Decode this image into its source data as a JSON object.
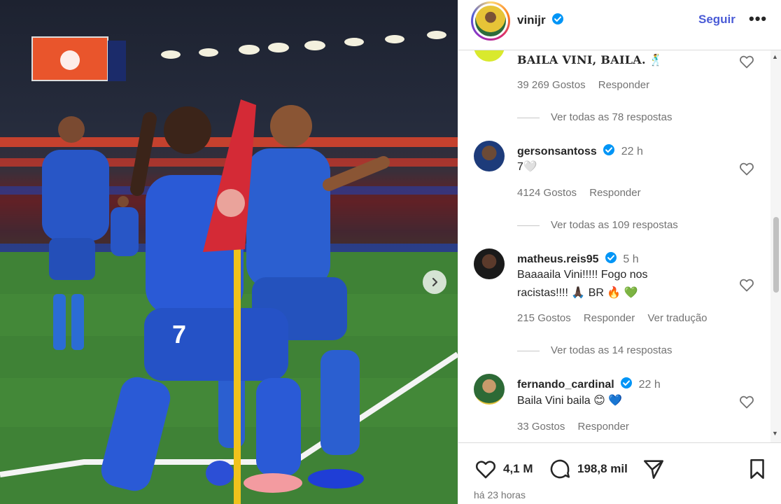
{
  "post": {
    "username": "vinijr",
    "follow_label": "Seguir",
    "more_label": "•••",
    "next_label": "›"
  },
  "comments": [
    {
      "username": "",
      "text": "BAILA VINI, BAILA.",
      "emoji": "🕺",
      "likes": "39 269 Gostos",
      "reply_label": "Responder",
      "view_replies": "Ver todas as 78 respostas"
    },
    {
      "username": "gersonsantoss",
      "time": "22 h",
      "text": "7",
      "emoji": "🤍",
      "likes": "4124 Gostos",
      "reply_label": "Responder",
      "view_replies": "Ver todas as 109 respostas"
    },
    {
      "username": "matheus.reis95",
      "time": "5 h",
      "text_line1": "Baaaaila Vini!!!!! Fogo nos",
      "text_line2": "racistas!!!!",
      "emoji": "🙏🏿 BR 🔥 💚",
      "likes": "215 Gostos",
      "reply_label": "Responder",
      "translate_label": "Ver tradução",
      "view_replies": "Ver todas as 14 respostas"
    },
    {
      "username": "fernando_cardinal",
      "time": "22 h",
      "text": "Baila Vini baila",
      "emoji": "😊 💙",
      "likes": "33 Gostos",
      "reply_label": "Responder"
    }
  ],
  "actions": {
    "likes": "4,1 M",
    "comments": "198,8 mil",
    "timestamp": "há 23 horas"
  },
  "colors": {
    "accent": "#4a5bd6",
    "verified": "#0095f6",
    "kit_blue": "#1f55c8"
  },
  "icons": [
    "verified-icon",
    "heart-icon",
    "comment-icon",
    "share-icon",
    "bookmark-icon",
    "chevron-right-icon"
  ]
}
